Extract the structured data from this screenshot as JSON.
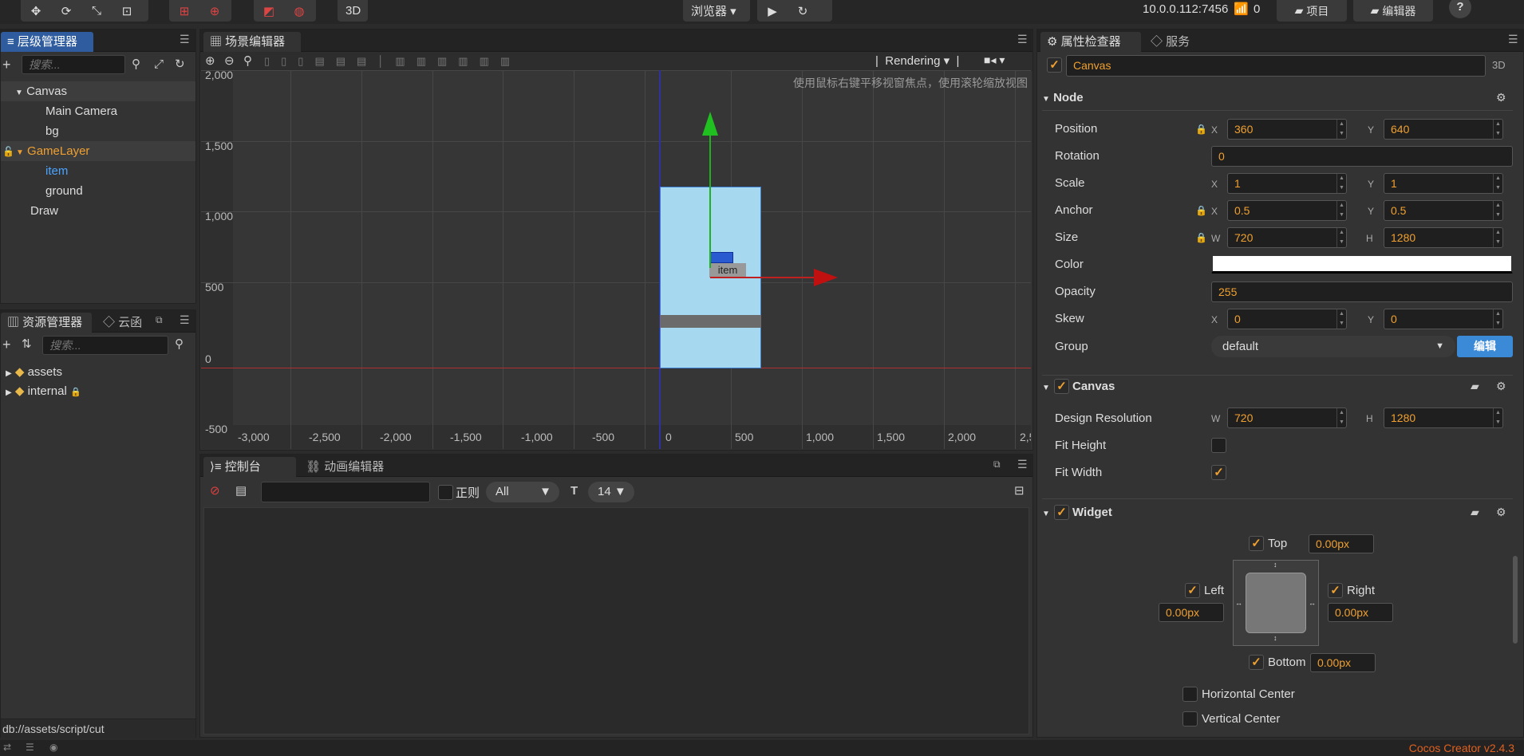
{
  "toolbar": {
    "browser_label": "浏览器 ▾",
    "mode_3d": "3D",
    "ip": "10.0.0.112:7456",
    "count": "0",
    "project_label": "项目",
    "editor_label": "编辑器"
  },
  "hierarchy": {
    "tab": "层级管理器",
    "search_placeholder": "搜索...",
    "items": [
      {
        "label": "Canvas"
      },
      {
        "label": "Main Camera"
      },
      {
        "label": "bg"
      },
      {
        "label": "GameLayer"
      },
      {
        "label": "item"
      },
      {
        "label": "ground"
      },
      {
        "label": "Draw"
      }
    ]
  },
  "assets": {
    "tab": "资源管理器",
    "tab2": "云函",
    "search_placeholder": "搜索...",
    "items": [
      {
        "label": "assets"
      },
      {
        "label": "internal"
      }
    ],
    "status_path": "db://assets/script/cut"
  },
  "scene": {
    "tab": "场景编辑器",
    "rendering": "Rendering",
    "hint": "使用鼠标右键平移视窗焦点，使用滚轮缩放视图",
    "y_labels": [
      "2,000",
      "1,500",
      "1,000",
      "500",
      "0",
      "-500"
    ],
    "x_labels": [
      "-3,000",
      "-2,500",
      "-2,000",
      "-1,500",
      "-1,000",
      "-500",
      "0",
      "500",
      "1,000",
      "1,500",
      "2,000",
      "2,5"
    ],
    "node_label": "item"
  },
  "console": {
    "tab": "控制台",
    "tab2": "动画编辑器",
    "regex_label": "正则",
    "level": "All",
    "font_size": "14"
  },
  "inspector": {
    "tab": "属性检查器",
    "tab2": "服务",
    "node_name": "Canvas",
    "mode": "3D",
    "node_section": "Node",
    "position": {
      "label": "Position",
      "x": "360",
      "y": "640"
    },
    "rotation": {
      "label": "Rotation",
      "value": "0"
    },
    "scale": {
      "label": "Scale",
      "x": "1",
      "y": "1"
    },
    "anchor": {
      "label": "Anchor",
      "x": "0.5",
      "y": "0.5"
    },
    "size": {
      "label": "Size",
      "w": "720",
      "h": "1280"
    },
    "color": {
      "label": "Color",
      "value": "#ffffff"
    },
    "opacity": {
      "label": "Opacity",
      "value": "255"
    },
    "skew": {
      "label": "Skew",
      "x": "0",
      "y": "0"
    },
    "group": {
      "label": "Group",
      "value": "default",
      "edit": "编辑"
    },
    "canvas_section": "Canvas",
    "design_resolution": {
      "label": "Design Resolution",
      "w": "720",
      "h": "1280"
    },
    "fit_height": {
      "label": "Fit Height",
      "checked": false
    },
    "fit_width": {
      "label": "Fit Width",
      "checked": true
    },
    "widget_section": "Widget",
    "widget": {
      "top": "Top",
      "top_val": "0.00px",
      "left": "Left",
      "left_val": "0.00px",
      "right": "Right",
      "right_val": "0.00px",
      "bottom": "Bottom",
      "bottom_val": "0.00px",
      "hcenter": "Horizontal Center",
      "vcenter": "Vertical Center"
    }
  },
  "footer": {
    "version": "Cocos Creator v2.4.3"
  },
  "colors": {
    "accent": "#f0a030",
    "tab_active": "#2e5c9e",
    "selected": "#4aa3ff",
    "gamelayer": "#f0a030"
  }
}
